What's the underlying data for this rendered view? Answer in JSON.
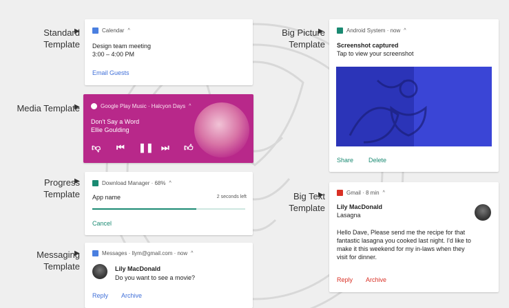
{
  "template_labels": {
    "standard": "Standard Template",
    "media": "Media Template",
    "progress": "Progress Template",
    "messaging": "Messaging Template",
    "big_picture": "Big Picture Template",
    "big_text": "Big Text Template"
  },
  "standard": {
    "app": "Calendar",
    "title": "Design team meeting",
    "time": "3:00 – 4:00 PM",
    "action": "Email Guests"
  },
  "media": {
    "header": "Google Play Music · Halcyon Days",
    "song": "Don't Say a Word",
    "artist": "Ellie Goulding",
    "controls": [
      "thumbs-down-icon",
      "previous-icon",
      "pause-icon",
      "next-icon",
      "thumbs-up-icon"
    ],
    "bg_color": "#b8288a"
  },
  "progress": {
    "header": "Download Manager · 68%",
    "file": "App name",
    "remaining": "2 seconds left",
    "progress": 0.68,
    "action": "Cancel",
    "accent": "#1a8a72"
  },
  "messaging": {
    "header": "Messages · llym@gmail.com · now",
    "sender": "Lily MacDonald",
    "message": "Do you want to see a movie?",
    "actions": [
      "Reply",
      "Archive"
    ]
  },
  "big_picture": {
    "header": "Android System · now",
    "title": "Screenshot captured",
    "subtitle": "Tap to view your screenshot",
    "actions": [
      "Share",
      "Delete"
    ]
  },
  "big_text": {
    "header": "Gmail · 8 min",
    "sender": "Lily MacDonald",
    "subject": "Lasagna",
    "body": [
      "Hello Dave,  Please send me the recipe for that",
      "fantastic lasagna you cooked last night. I'd like to",
      "make it this weekend for my in-laws when they",
      "visit for dinner."
    ],
    "actions": [
      "Reply",
      "Archive"
    ],
    "accent": "#d93025"
  }
}
